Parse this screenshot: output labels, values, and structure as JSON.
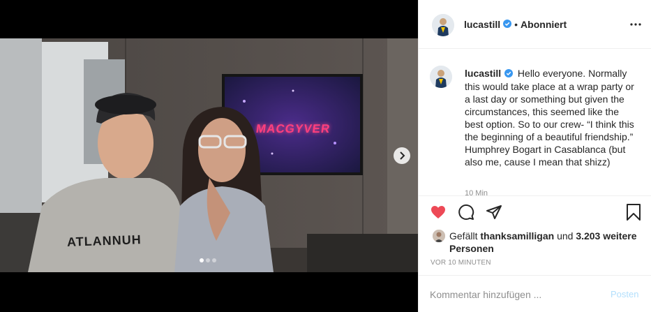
{
  "post": {
    "username": "lucastill",
    "follow_status": "Abonniert",
    "separator": "•",
    "caption": "Hello everyone. Normally this would take place at a wrap party or a last day or something but given the circumstances, this seemed like the best option. So to our crew- “I think this the beginning of a beautiful friendship.” Humphrey Bogart in Casablanca (but also me, cause I mean that shizz)",
    "caption_time_partial": "10 Min",
    "liked": true,
    "likes_prefix": "Gefällt",
    "liked_by": "thanksamilligan",
    "likes_join": "und",
    "likes_others": "3.203 weitere Personen",
    "time": "VOR 10 MINUTEN",
    "carousel": {
      "slides": 3,
      "current": 1
    }
  },
  "media": {
    "tv_text": "MACGYVER",
    "shirt_text": "ATLANNUH"
  },
  "comment": {
    "placeholder": "Kommentar hinzufügen ...",
    "post_label": "Posten"
  },
  "colors": {
    "like_red": "#ed4956",
    "verified_blue": "#3897f0",
    "post_button_disabled": "#b2dffc",
    "muted": "#8e8e8e"
  },
  "icons": {
    "like": "heart-icon",
    "comment": "comment-icon",
    "share": "share-icon",
    "save": "bookmark-icon",
    "more": "more-icon",
    "next": "chevron-right-icon",
    "verified": "verified-badge-icon"
  }
}
